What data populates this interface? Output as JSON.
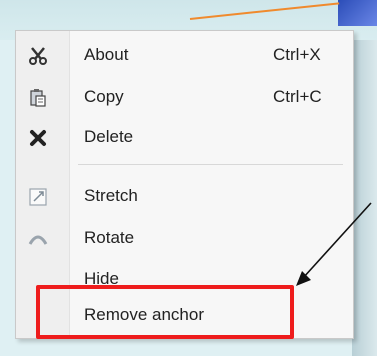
{
  "menu": {
    "items": [
      {
        "label": "About",
        "shortcut": "Ctrl+X",
        "icon": "scissors-icon"
      },
      {
        "label": "Copy",
        "shortcut": "Ctrl+C",
        "icon": "clipboard-icon"
      },
      {
        "label": "Delete",
        "shortcut": "",
        "icon": "x-icon"
      },
      {
        "label": "Stretch",
        "shortcut": "",
        "icon": "stretch-icon"
      },
      {
        "label": "Rotate",
        "shortcut": "",
        "icon": "rotate-icon"
      },
      {
        "label": "Hide",
        "shortcut": "",
        "icon": ""
      },
      {
        "label": "Remove anchor",
        "shortcut": "",
        "icon": ""
      }
    ]
  },
  "colors": {
    "highlight": "#ee1c1c",
    "menu_bg": "#f7f7f7",
    "arrow": "#111111"
  }
}
